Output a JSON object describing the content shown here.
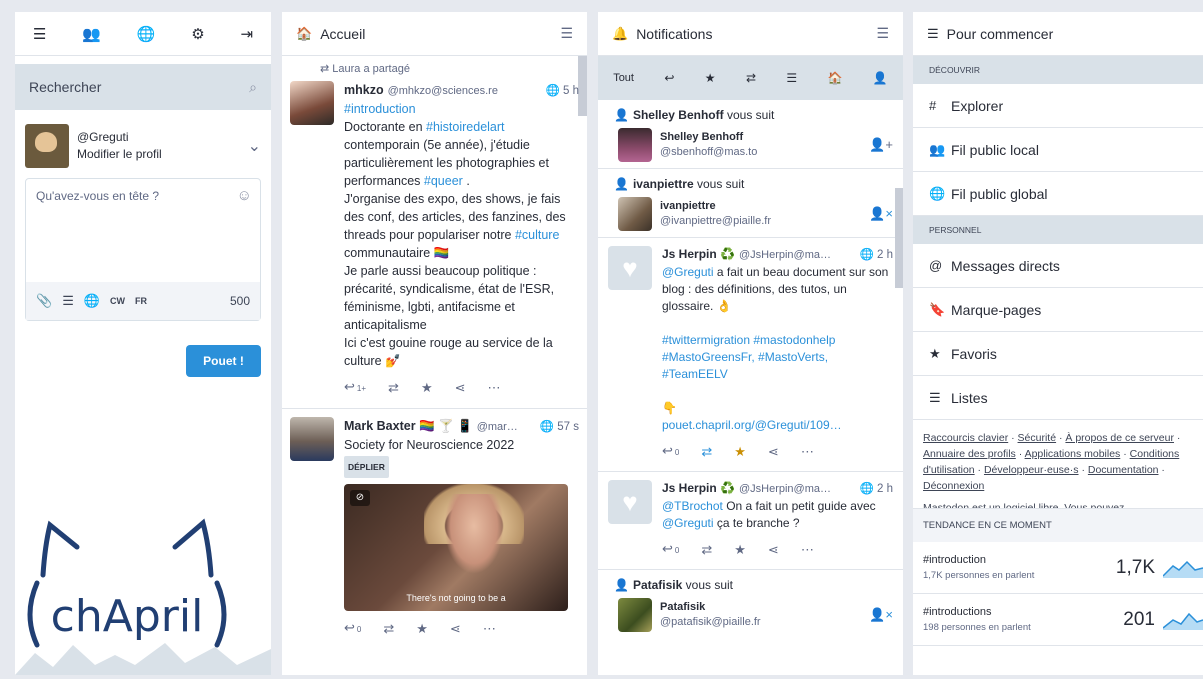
{
  "colors": {
    "accent": "#2b90d9",
    "favorite": "#ca8f04",
    "muted": "#606984",
    "bar_bg": "#d9e1e8"
  },
  "nav": {
    "icons": [
      "menu-icon",
      "people-icon",
      "globe-icon",
      "gear-icon",
      "logout-icon"
    ]
  },
  "search": {
    "placeholder": "Rechercher"
  },
  "profile": {
    "handle": "@Greguti",
    "edit": "Modifier le profil"
  },
  "composer": {
    "placeholder": "Qu'avez-vous en tête ?",
    "cw": "CW",
    "lang": "FR",
    "count": "500",
    "submit": "Pouet !"
  },
  "logo": {
    "text": "chApril"
  },
  "home": {
    "title": "Accueil",
    "boost_line": "Laura a partagé",
    "s1": {
      "name": "mhkzo",
      "account": "@mhkzo@sciences.re",
      "time": "5 h",
      "tag": "#introduction",
      "l1": "Doctorante en ",
      "l1tag": "#histoiredelart",
      "l2": "contemporain (5e année), j'étudie particulièrement les photographies et performances ",
      "l2tag": "#queer",
      "l2end": " .",
      "l3": "J'organise des expo, des shows, je fais des conf, des articles, des fanzines, des threads pour populariser notre ",
      "l3tag": "#culture",
      "l3end": " communautaire 🏳️‍🌈",
      "l4": "Je parle aussi beaucoup politique : précarité, syndicalisme, état de l'ESR, féminisme, lgbti, antifacisme et anticapitalisme",
      "l5": "Ici c'est gouine rouge au service de la culture 💅",
      "reply_count": "1+"
    },
    "s2": {
      "name": "Mark Baxter 🏳️‍🌈 🍸 📱",
      "account": "@mar…",
      "time": "57 s",
      "text": "Society for Neuroscience 2022",
      "sensitive": "DÉPLIER",
      "caption": "There's not going to be a",
      "reply_count": "0"
    }
  },
  "notifications": {
    "title": "Notifications",
    "tab_all": "Tout",
    "n1": {
      "line_name": "Shelley Benhoff",
      "line_rest": " vous suit",
      "name": "Shelley Benhoff",
      "account": "@sbenhoff@mas.to"
    },
    "n2": {
      "line_name": "ivanpiettre",
      "line_rest": " vous suit",
      "name": "ivanpiettre",
      "account": "@ivanpiettre@piaille.fr"
    },
    "n3": {
      "name": "Js Herpin ♻️",
      "account": "@JsHerpin@ma…",
      "time": "2 h",
      "mention": "@Greguti",
      "t1": " a fait un beau document sur son blog : des définitions, des tutos, un glossaire. 👌",
      "tags": "#twittermigration #mastodonhelp #MastoGreensFr, #MastoVerts, #TeamEELV",
      "emoji": "👇",
      "link": "pouet.chapril.org/@Greguti/109…",
      "reply_count": "0"
    },
    "n4": {
      "name": "Js Herpin ♻️",
      "account": "@JsHerpin@ma…",
      "time": "2 h",
      "m1": "@TBrochot",
      "t1": " On a fait un petit guide avec ",
      "m2": "@Greguti",
      "t2": " ça te branche ?",
      "reply_count": "0"
    },
    "n5": {
      "line_name": "Patafisik",
      "line_rest": " vous suit",
      "name": "Patafisik",
      "account": "@patafisik@piaille.fr"
    }
  },
  "start": {
    "title": "Pour commencer",
    "discover": "DÉCOUVRIR",
    "explore": "Explorer",
    "local": "Fil public local",
    "global": "Fil public global",
    "personal": "PERSONNEL",
    "dm": "Messages directs",
    "bookmarks": "Marque-pages",
    "favourites": "Favoris",
    "lists": "Listes",
    "links": [
      "Raccourcis clavier",
      "Sécurité",
      "À propos de ce serveur",
      "Annuaire des profils",
      "Applications mobiles",
      "Conditions d'utilisation",
      "Développeur·euse·s",
      "Documentation",
      "Déconnexion"
    ],
    "footer": "Mastodon est un logiciel libre. Vous pouvez",
    "trending_title": "TENDANCE EN CE MOMENT",
    "trends": [
      {
        "tag": "#introduction",
        "sub": "1,7K personnes en parlent",
        "value": "1,7K"
      },
      {
        "tag": "#introductions",
        "sub": "198 personnes en parlent",
        "value": "201"
      }
    ]
  }
}
